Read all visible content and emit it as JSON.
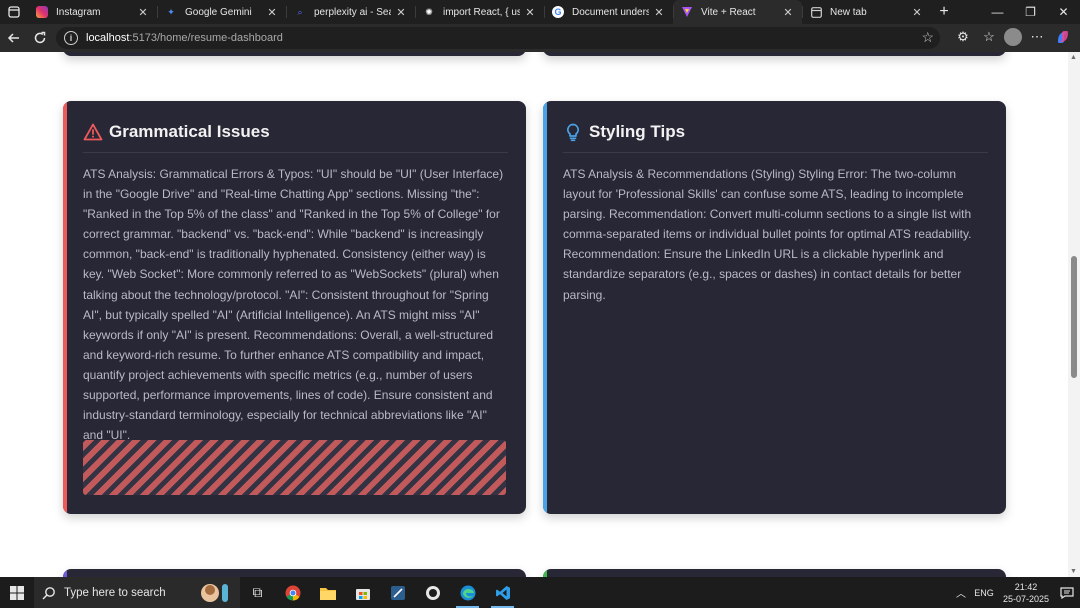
{
  "browser": {
    "tabs": [
      {
        "title": "Instagram",
        "icon": "instagram-icon",
        "color": "#e1306c",
        "active": false
      },
      {
        "title": "Google Gemini",
        "icon": "gemini-icon",
        "color": "#4f8df5",
        "active": false
      },
      {
        "title": "perplexity ai - Search",
        "icon": "search-icon",
        "color": "#5a6cff",
        "active": false
      },
      {
        "title": "import React, { useStat",
        "icon": "openai-icon",
        "color": "#ffffff",
        "active": false
      },
      {
        "title": "Document understand",
        "icon": "google-icon",
        "color": "#ffffff",
        "active": false
      },
      {
        "title": "Vite + React",
        "icon": "vite-icon",
        "color": "#a855f7",
        "active": true
      },
      {
        "title": "New tab",
        "icon": "new-tab-page-icon",
        "color": "#cfcfcf",
        "active": false
      }
    ],
    "url_host": "localhost",
    "url_path": ":5173/home/resume-dashboard"
  },
  "cards": {
    "grammar": {
      "title": "Grammatical Issues",
      "accent": "#ee5a5a",
      "body": "ATS Analysis: Grammatical Errors & Typos: \"UI\" should be \"UI\" (User Interface) in the \"Google Drive\" and \"Real-time Chatting App\" sections. Missing \"the\": \"Ranked in the Top 5% of the class\" and \"Ranked in the Top 5% of College\" for correct grammar. \"backend\" vs. \"back-end\": While \"backend\" is increasingly common, \"back-end\" is traditionally hyphenated. Consistency (either way) is key. \"Web Socket\": More commonly referred to as \"WebSockets\" (plural) when talking about the technology/protocol. \"AI\": Consistent throughout for \"Spring AI\", but typically spelled \"AI\" (Artificial Intelligence). An ATS might miss \"AI\" keywords if only \"AI\" is present. Recommendations: Overall, a well-structured and keyword-rich resume. To further enhance ATS compatibility and impact, quantify project achievements with specific metrics (e.g., number of users supported, performance improvements, lines of code). Ensure consistent and industry-standard terminology, especially for technical abbreviations like \"AI\" and \"UI\"."
    },
    "styling": {
      "title": "Styling Tips",
      "accent": "#4aa3e6",
      "body": "ATS Analysis & Recommendations (Styling) Styling Error: The two-column layout for 'Professional Skills' can confuse some ATS, leading to incomplete parsing. Recommendation: Convert multi-column sections to a single list with comma-separated items or individual bullet points for optimal ATS readability. Recommendation: Ensure the LinkedIn URL is a clickable hyperlink and standardize separators (e.g., spaces or dashes) in contact details for better parsing."
    }
  },
  "taskbar": {
    "search_placeholder": "Type here to search",
    "apps": [
      "task-view-icon",
      "chrome-icon",
      "file-explorer-icon",
      "store-icon",
      "app-icon",
      "app-icon-2",
      "edge-icon",
      "vscode-icon"
    ],
    "language": "ENG",
    "time": "21:42",
    "date": "25-07-2025"
  }
}
